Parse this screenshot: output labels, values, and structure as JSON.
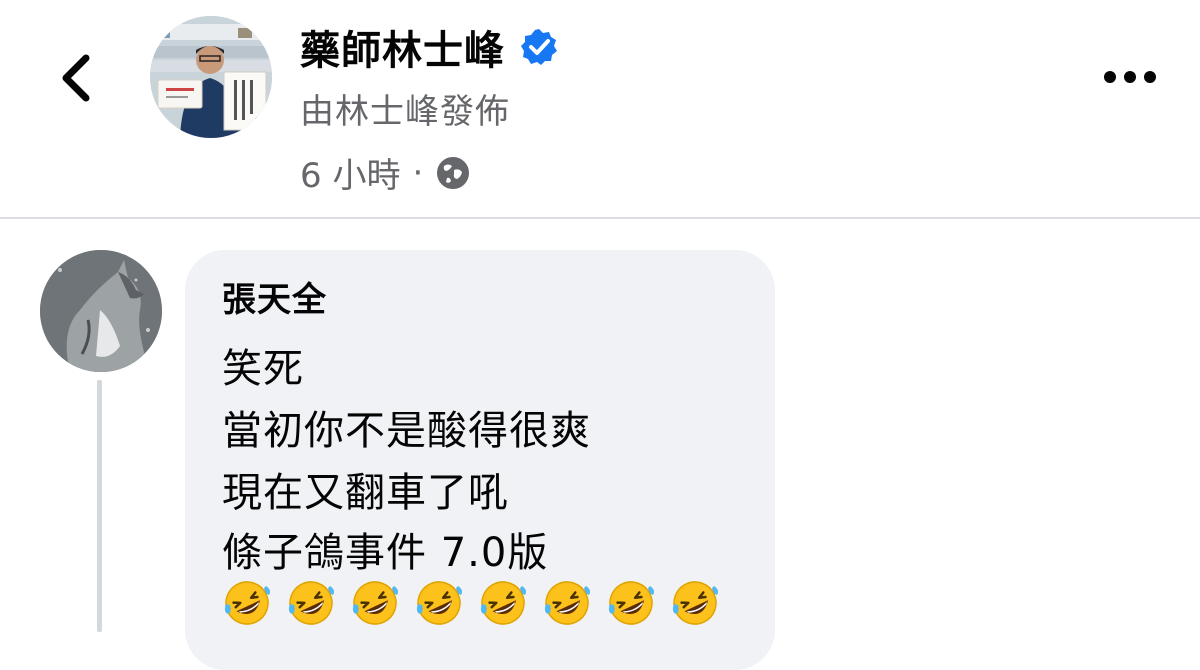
{
  "post_header": {
    "page_name": "藥師林士峰",
    "posted_by": "由林士峰發佈",
    "time": "6 小時",
    "separator": "·"
  },
  "comment": {
    "author": "張天全",
    "lines": [
      "笑死",
      "當初你不是酸得很爽",
      "現在又翻車了吼",
      "條子鴿事件 7.0版"
    ],
    "emoji": "rolling-on-floor-laughing",
    "emoji_count": 8
  },
  "icons": {
    "back": "chevron-left-icon",
    "verified": "verified-badge-icon",
    "audience": "globe-icon",
    "more": "more-horizontal-icon"
  },
  "colors": {
    "verified_blue": "#1877f2",
    "secondary_text": "#65676b",
    "bubble_bg": "#f0f2f5",
    "emoji_yellow": "#fcc21b"
  }
}
